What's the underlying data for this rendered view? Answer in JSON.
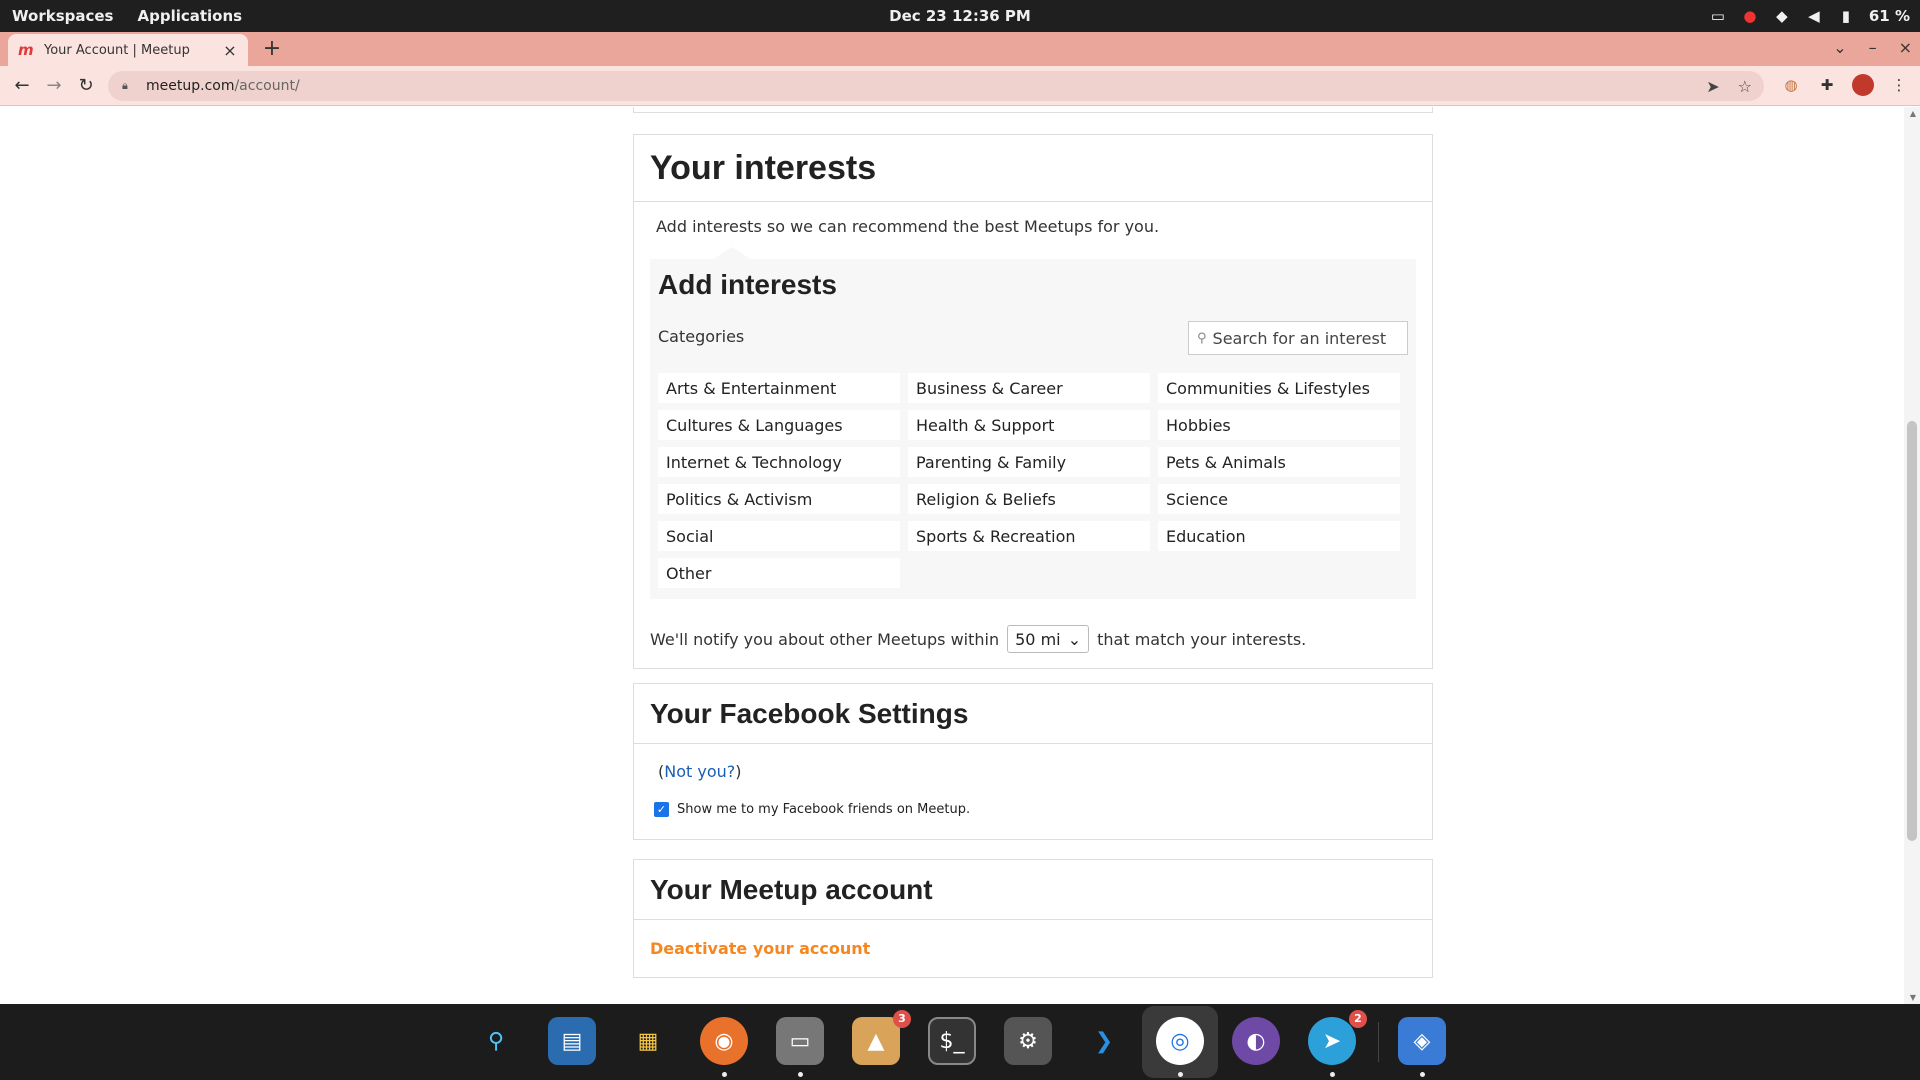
{
  "system": {
    "workspaces": "Workspaces",
    "applications": "Applications",
    "clock": "Dec 23  12:36 PM",
    "battery": "61 %"
  },
  "browser": {
    "tab_title": "Your Account | Meetup",
    "url_host": "meetup.com",
    "url_path": "/account/"
  },
  "interests": {
    "title": "Your interests",
    "intro": "Add interests so we can recommend the best Meetups for you.",
    "add_title": "Add interests",
    "categories_label": "Categories",
    "search_placeholder": "Search for an interest",
    "categories": [
      "Arts & Entertainment",
      "Business & Career",
      "Communities & Lifestyles",
      "Cultures & Languages",
      "Health & Support",
      "Hobbies",
      "Internet & Technology",
      "Parenting & Family",
      "Pets & Animals",
      "Politics & Activism",
      "Religion & Beliefs",
      "Science",
      "Social",
      "Sports & Recreation",
      "Education",
      "Other"
    ],
    "notify_prefix": "We'll notify you about other Meetups within",
    "radius_value": "50 mi",
    "notify_suffix": "that match your interests."
  },
  "facebook": {
    "title": "Your Facebook Settings",
    "open_paren": "(",
    "not_you": "Not you?",
    "close_paren": ")",
    "show_me_label": "Show me to my Facebook friends on Meetup.",
    "show_me_checked": true
  },
  "account": {
    "title": "Your Meetup account",
    "deactivate": "Deactivate your account"
  },
  "dock": {
    "badges": {
      "archive": "3",
      "telegram": "2"
    }
  },
  "colors": {
    "tab_strip": "#eba69b",
    "link": "#1a5fb4",
    "deactivate": "#f6861f",
    "checkbox": "#1a73e8"
  }
}
